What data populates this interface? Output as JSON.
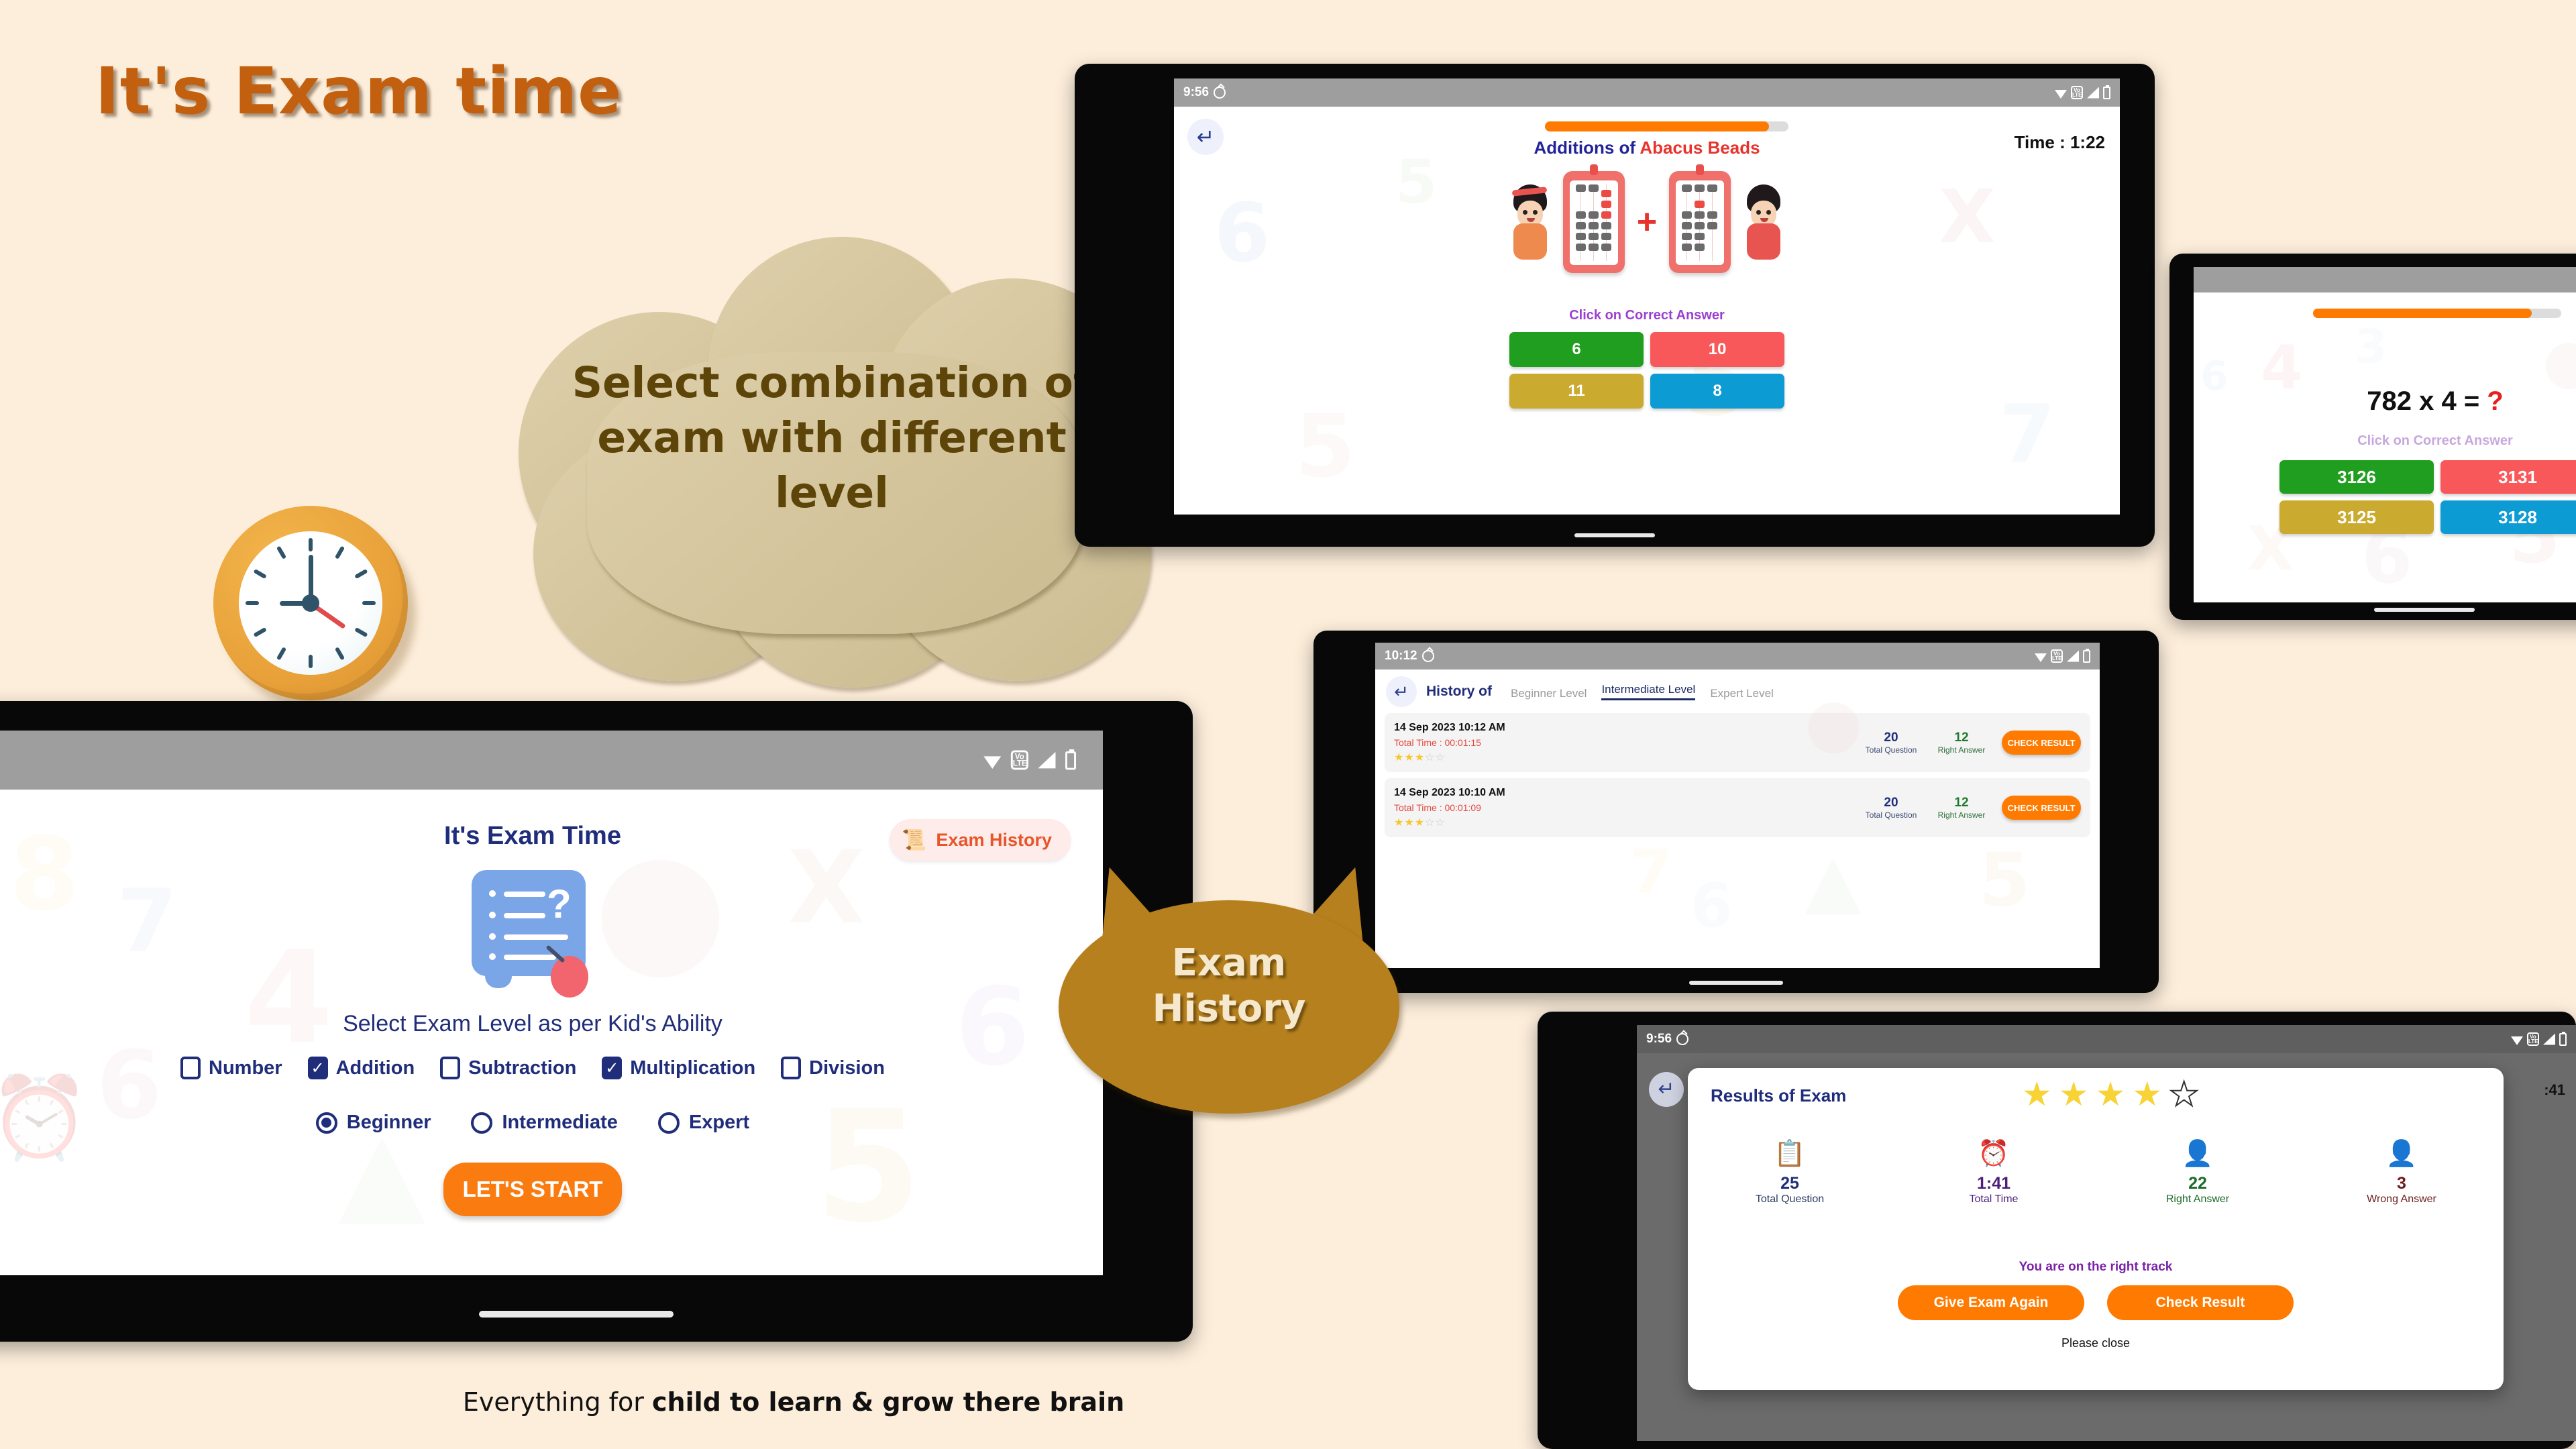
{
  "headline": "It's Exam time",
  "cloud": {
    "text": "Select combination of exam with different level"
  },
  "callout": {
    "line1": "Exam",
    "line2": "History"
  },
  "tagline": {
    "normal": "Everything for ",
    "bold": "child to learn & grow there brain"
  },
  "colors": {
    "background": "#fdeedb",
    "accent_orange": "#ff7a00",
    "headline_orange": "#c2600f",
    "cloud_fill": "#d4c49e",
    "callout_fill": "#b5801d",
    "navy": "#1f2d7a",
    "answer_green": "#1f9e1f",
    "answer_red": "#f9585a",
    "answer_gold": "#cbaa30",
    "answer_blue": "#0d9bd4"
  },
  "quiz_abacus": {
    "status_bar": {
      "time": "9:56",
      "icons": [
        "bug-icon",
        "wifi-icon",
        "volte-icon",
        "signal-icon",
        "battery-icon"
      ],
      "volte_label_top": "Vo",
      "volte_label_bottom": "LTE"
    },
    "back_icon": "back-arrow-icon",
    "progress_percent": 92,
    "title_primary": "Additions of",
    "title_secondary": "Abacus Beads",
    "timer_label": "Time : 1:22",
    "hint": "Click on Correct Answer",
    "answers": [
      {
        "label": "6",
        "color": "#1f9e1f"
      },
      {
        "label": "10",
        "color": "#f9585a"
      },
      {
        "label": "11",
        "color": "#cbaa30"
      },
      {
        "label": "8",
        "color": "#0d9bd4"
      }
    ],
    "operator": "+"
  },
  "quiz_multiplication": {
    "progress_percent": 88,
    "question": "782 x 4 = ",
    "question_unknown": "?",
    "hint": "Click on Correct Answer",
    "answers": [
      {
        "label": "3126",
        "color": "#1f9e1f"
      },
      {
        "label": "3131",
        "color": "#f9585a"
      },
      {
        "label": "3125",
        "color": "#cbaa30"
      },
      {
        "label": "3128",
        "color": "#0d9bd4"
      }
    ]
  },
  "history": {
    "status_bar": {
      "time": "10:12"
    },
    "back_icon": "back-arrow-icon",
    "title": "History of",
    "tabs": [
      {
        "label": "Beginner Level",
        "active": false
      },
      {
        "label": "Intermediate Level",
        "active": true
      },
      {
        "label": "Expert Level",
        "active": false
      }
    ],
    "col_total_label": "Total Question",
    "col_right_label": "Right Answer",
    "action_label": "CHECK RESULT",
    "rows": [
      {
        "date": "14 Sep 2023 10:12 AM",
        "total_time": "Total Time : 00:01:15",
        "stars": 3,
        "total_question": "20",
        "right_answer": "12"
      },
      {
        "date": "14 Sep 2023 10:10 AM",
        "total_time": "Total Time : 00:01:09",
        "stars": 3,
        "total_question": "20",
        "right_answer": "12"
      }
    ]
  },
  "results": {
    "status_bar": {
      "time": "9:56"
    },
    "timer_partial": ":41",
    "title": "Results of Exam",
    "stars_filled": 4,
    "stars_total": 5,
    "stats": [
      {
        "icon": "clipboard-icon",
        "value": "25",
        "label": "Total Question"
      },
      {
        "icon": "alarm-clock-icon",
        "value": "1:41",
        "label": "Total Time"
      },
      {
        "icon": "right-answer-icon",
        "value": "22",
        "label": "Right Answer"
      },
      {
        "icon": "wrong-answer-icon",
        "value": "3",
        "label": "Wrong Answer"
      }
    ],
    "message": "You are on the right track",
    "buttons": [
      {
        "label": "Give Exam Again"
      },
      {
        "label": "Check Result"
      }
    ],
    "close_hint": "Please close"
  },
  "home": {
    "status_bar": {
      "icons": [
        "wifi-icon",
        "volte-icon",
        "signal-icon",
        "battery-icon"
      ]
    },
    "title": "It's Exam Time",
    "history_button": {
      "label": "Exam History",
      "icon": "history-scroll-icon"
    },
    "subtitle": "Select Exam Level as per Kid's Ability",
    "quiz_icon": "quiz-card-icon",
    "operations": [
      {
        "label": "Number",
        "checked": false
      },
      {
        "label": "Addition",
        "checked": true
      },
      {
        "label": "Subtraction",
        "checked": false
      },
      {
        "label": "Multiplication",
        "checked": true
      },
      {
        "label": "Division",
        "checked": false
      }
    ],
    "levels": [
      {
        "label": "Beginner",
        "selected": true
      },
      {
        "label": "Intermediate",
        "selected": false
      },
      {
        "label": "Expert",
        "selected": false
      }
    ],
    "start_button": "LET'S START"
  }
}
